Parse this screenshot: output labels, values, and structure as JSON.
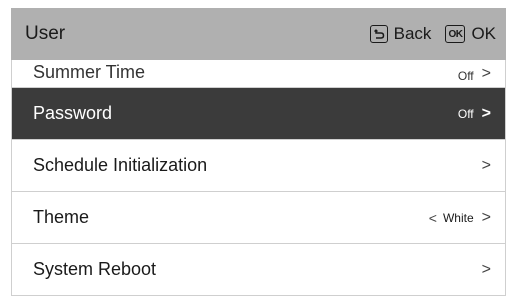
{
  "header": {
    "title": "User",
    "back_icon": "back-key-icon",
    "back_label": "Back",
    "ok_icon_text": "OK",
    "ok_label": "OK"
  },
  "menu": {
    "items": [
      {
        "label": "Summer Time",
        "value": "Off",
        "chevron": ">"
      },
      {
        "label": "Password",
        "value": "Off",
        "chevron": ">",
        "selected": true
      },
      {
        "label": "Schedule Initialization",
        "value": "",
        "chevron": ">"
      },
      {
        "label": "Theme",
        "value": "White",
        "chevron_left": "<",
        "chevron": ">"
      },
      {
        "label": "System Reboot",
        "value": "",
        "chevron": ">"
      }
    ]
  },
  "colors": {
    "header_bg": "#b0b0b0",
    "selected_bg": "#3b3b3b",
    "text": "#1a1a1a"
  }
}
